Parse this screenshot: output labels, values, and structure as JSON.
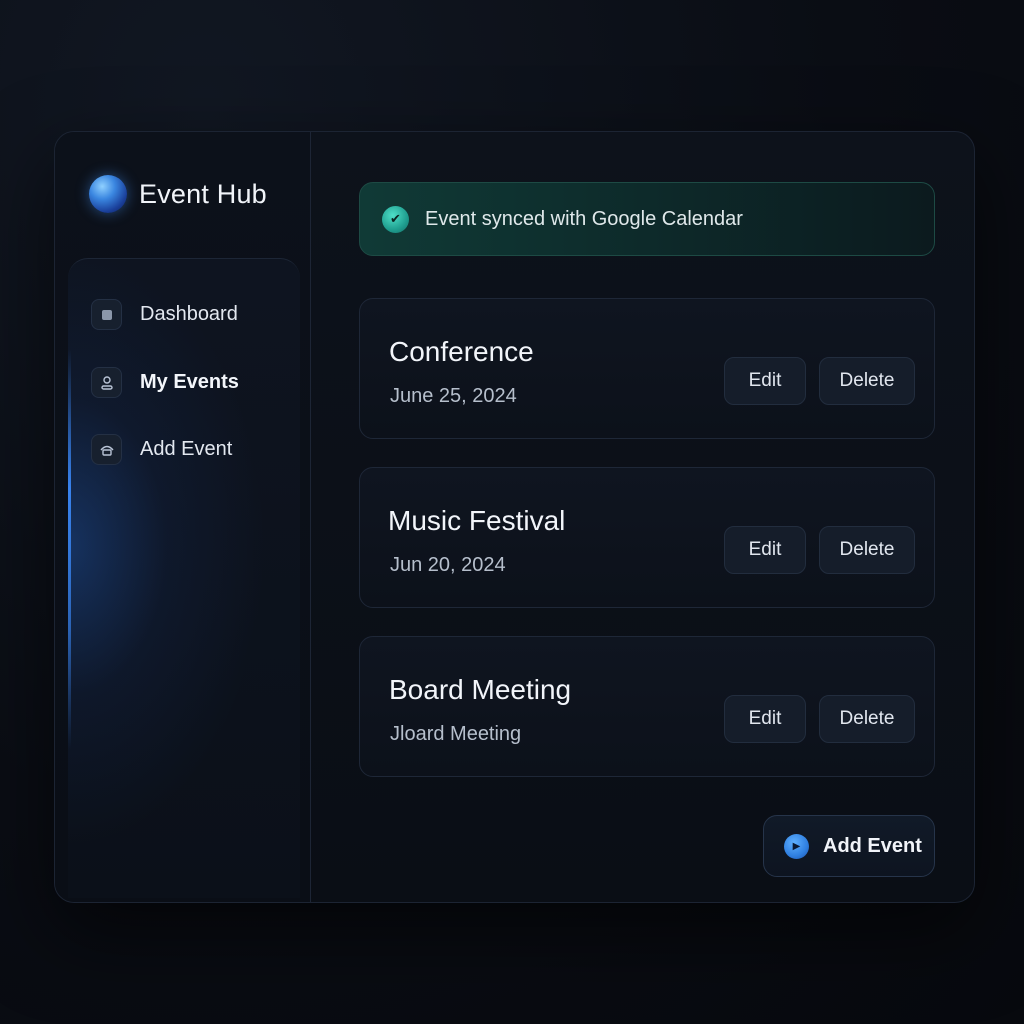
{
  "app": {
    "name": "Event Hub"
  },
  "sidebar": {
    "items": [
      {
        "label": "Dashboard",
        "icon": "dashboard-icon"
      },
      {
        "label": "My Events",
        "icon": "user-icon",
        "active": true
      },
      {
        "label": "Add Event",
        "icon": "add-event-icon"
      }
    ]
  },
  "toast": {
    "text": "Event synced with Google Calendar",
    "icon": "check-icon"
  },
  "events": [
    {
      "title": "Conference",
      "date": "June 25, 2024",
      "edit_label": "Edit",
      "delete_label": "Delete"
    },
    {
      "title": "Music Festival",
      "date": "Jun 20, 2024",
      "edit_label": "Edit",
      "delete_label": "Delete"
    },
    {
      "title": "Board Meeting",
      "date": "Jloard Meeting",
      "edit_label": "Edit",
      "delete_label": "Delete"
    }
  ],
  "add_button": {
    "label": "Add Event",
    "icon": "play-icon"
  },
  "colors": {
    "accent": "#3a86e0",
    "success": "#1f9e8f",
    "background": "#0a0d14"
  }
}
